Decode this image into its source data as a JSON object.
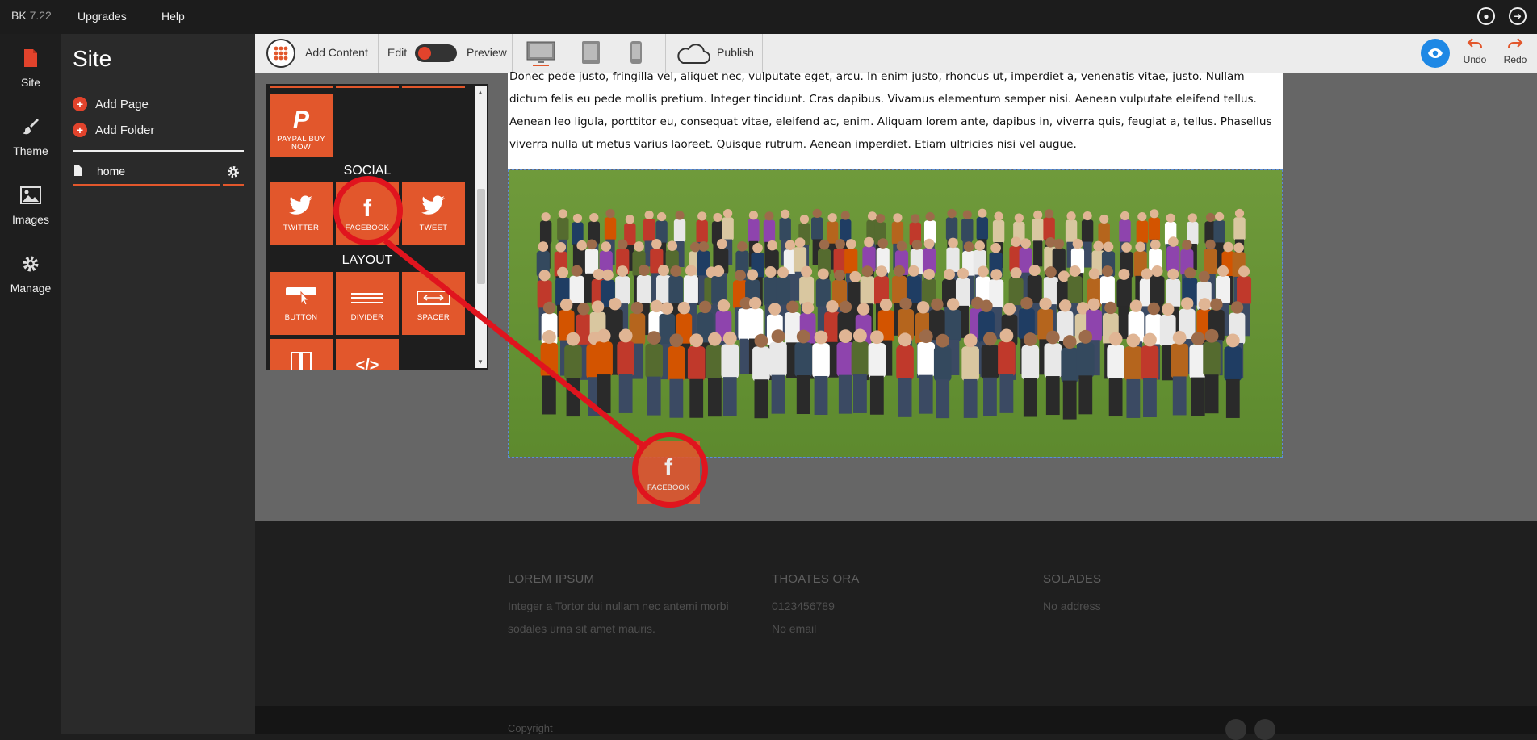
{
  "topbar": {
    "logo": "BK",
    "version": "7.22",
    "menu": [
      "Upgrades",
      "Help"
    ]
  },
  "leftnav": [
    {
      "label": "Site",
      "icon": "page-icon"
    },
    {
      "label": "Theme",
      "icon": "brush-icon"
    },
    {
      "label": "Images",
      "icon": "image-icon"
    },
    {
      "label": "Manage",
      "icon": "gear-icon"
    }
  ],
  "sitepanel": {
    "title": "Site",
    "add_page": "Add Page",
    "add_folder": "Add Folder",
    "pages": [
      {
        "name": "home"
      }
    ]
  },
  "toolbar": {
    "add_content": "Add Content",
    "edit": "Edit",
    "preview": "Preview",
    "publish": "Publish",
    "undo": "Undo",
    "redo": "Redo"
  },
  "palette": {
    "tiles_top": [
      {
        "label": "PAYPAL BUY NOW",
        "icon": "paypal-icon"
      }
    ],
    "section_social": "SOCIAL",
    "social": [
      {
        "label": "TWITTER",
        "icon": "twitter-icon"
      },
      {
        "label": "FACEBOOK",
        "icon": "facebook-icon"
      },
      {
        "label": "TWEET",
        "icon": "tweet-icon"
      }
    ],
    "section_layout": "LAYOUT",
    "layout": [
      {
        "label": "BUTTON",
        "icon": "button-icon"
      },
      {
        "label": "DIVIDER",
        "icon": "divider-icon"
      },
      {
        "label": "SPACER",
        "icon": "spacer-icon"
      }
    ],
    "layout_more": [
      {
        "label": "",
        "icon": "columns-icon"
      },
      {
        "label": "</>",
        "icon": "code-icon"
      }
    ]
  },
  "content": {
    "body_text": "Donec pede justo, fringilla vel, aliquet nec, vulputate eget, arcu. In enim justo, rhoncus ut, imperdiet a, venenatis vitae, justo. Nullam dictum felis eu pede mollis pretium. Integer tincidunt. Cras dapibus. Vivamus elementum semper nisi. Aenean vulputate eleifend tellus. Aenean leo ligula, porttitor eu, consequat vitae, eleifend ac, enim. Aliquam lorem ante, dapibus in, viverra quis, feugiat a, tellus. Phasellus viverra nulla ut metus varius laoreet. Quisque rutrum. Aenean imperdiet. Etiam ultricies nisi vel augue."
  },
  "drag_ghost": {
    "label": "FACEBOOK",
    "icon": "facebook-icon"
  },
  "footer": {
    "col1_title": "LOREM IPSUM",
    "col1_text": "Integer a Tortor dui nullam nec antemi morbi sodales urna sit amet mauris.",
    "col2_title": "THOATES ORA",
    "col2_phone": "0123456789",
    "col2_email": "No email",
    "col3_title": "SOLADES",
    "col3_address": "No address",
    "copyright": "Copyright"
  },
  "colors": {
    "accent": "#e2572c",
    "annotation": "#e0141e",
    "toolbar_bg": "#ececec",
    "preview_eye": "#1e88e5"
  }
}
